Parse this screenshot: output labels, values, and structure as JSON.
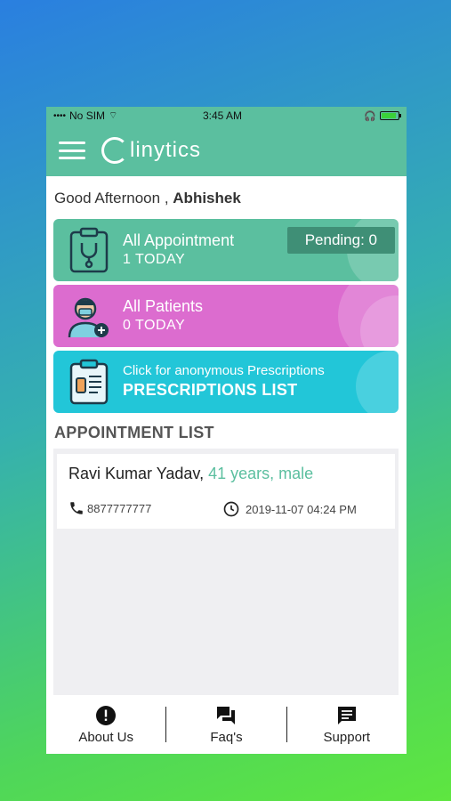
{
  "status_bar": {
    "carrier": "No SIM",
    "time": "3:45 AM"
  },
  "app": {
    "logo_text": "linytics"
  },
  "greeting": {
    "prefix": "Good Afternoon ,",
    "name": "Abhishek"
  },
  "cards": {
    "appointment": {
      "title": "All Appointment",
      "subtitle": "1 TODAY",
      "pending_label": "Pending: 0",
      "color": "#5bbf9f"
    },
    "patients": {
      "title": "All Patients",
      "subtitle": "0 TODAY",
      "color": "#dc6ccf"
    },
    "prescriptions": {
      "title": "Click for anonymous Prescriptions",
      "subtitle": "PRESCRIPTIONS LIST",
      "color": "#22c6d8"
    }
  },
  "appointment_list": {
    "title": "APPOINTMENT LIST",
    "items": [
      {
        "name": "Ravi Kumar Yadav,",
        "age_gender": "41 years, male",
        "phone": "8877777777",
        "datetime": "2019-11-07 04:24 PM"
      }
    ]
  },
  "bottom_nav": [
    {
      "label": "About Us",
      "icon": "info-icon"
    },
    {
      "label": "Faq's",
      "icon": "chat-icon"
    },
    {
      "label": "Support",
      "icon": "message-icon"
    }
  ]
}
